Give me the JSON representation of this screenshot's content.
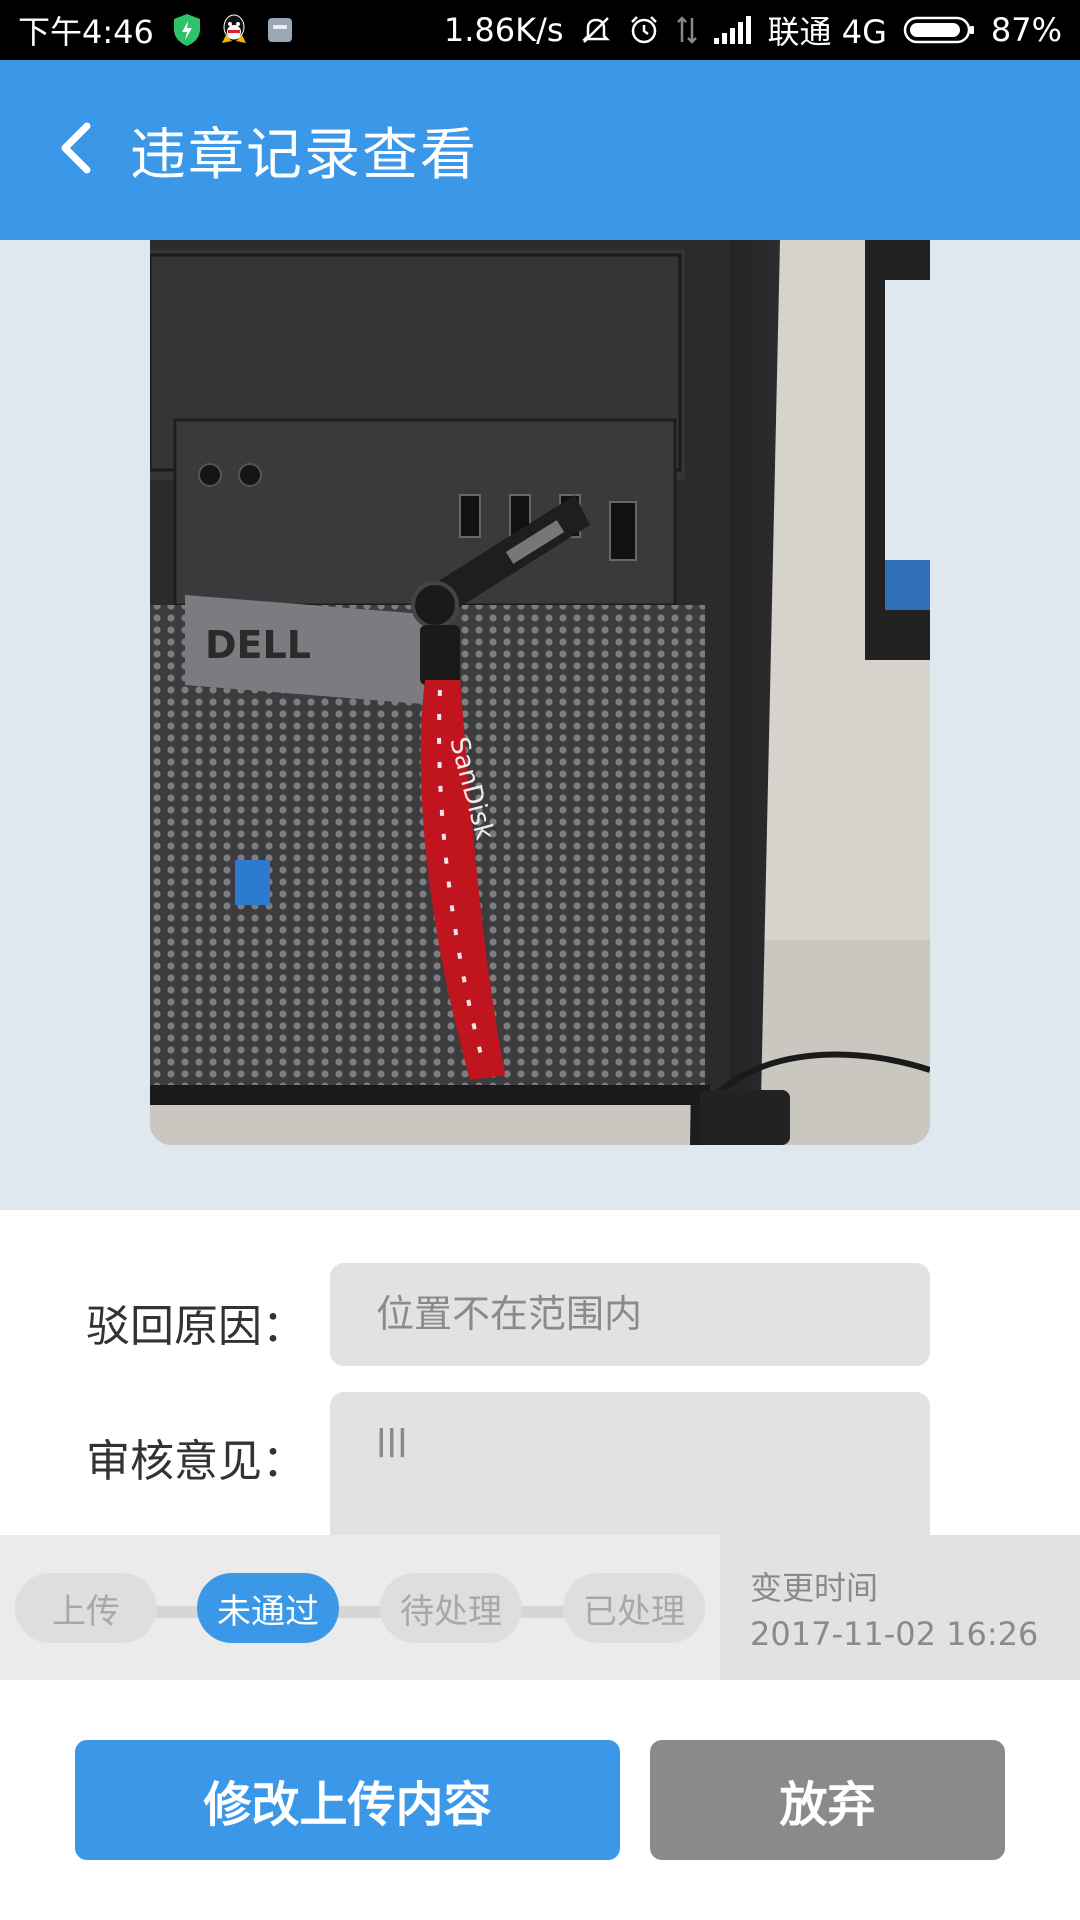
{
  "status_bar": {
    "time": "下午4:46",
    "network_speed": "1.86K/s",
    "carrier": "联通 4G",
    "battery": "87%",
    "icons": [
      "shield-icon",
      "qq-icon",
      "sim-icon",
      "mute-icon",
      "alarm-icon",
      "data-icon",
      "signal-icon",
      "battery-icon"
    ]
  },
  "app_bar": {
    "back_icon": "chevron-left-icon",
    "title": "违章记录查看"
  },
  "photo": {
    "brand_label": "DELL",
    "lanyard_text": "SanDisk"
  },
  "form": {
    "reject_reason_label": "驳回原因：",
    "reject_reason_value": "位置不在范围内",
    "review_opinion_label": "审核意见：",
    "review_opinion_value": "lll"
  },
  "progress": {
    "steps": [
      "上传",
      "未通过",
      "待处理",
      "已处理"
    ],
    "active_step": "未通过",
    "change_time_label": "变更时间",
    "change_time_value": "2017-11-02 16:26"
  },
  "actions": {
    "modify_label": "修改上传内容",
    "abandon_label": "放弃"
  },
  "colors": {
    "primary": "#3b98e8",
    "secondary_button": "#8a8a8a",
    "photo_background": "#e0e8ef"
  }
}
